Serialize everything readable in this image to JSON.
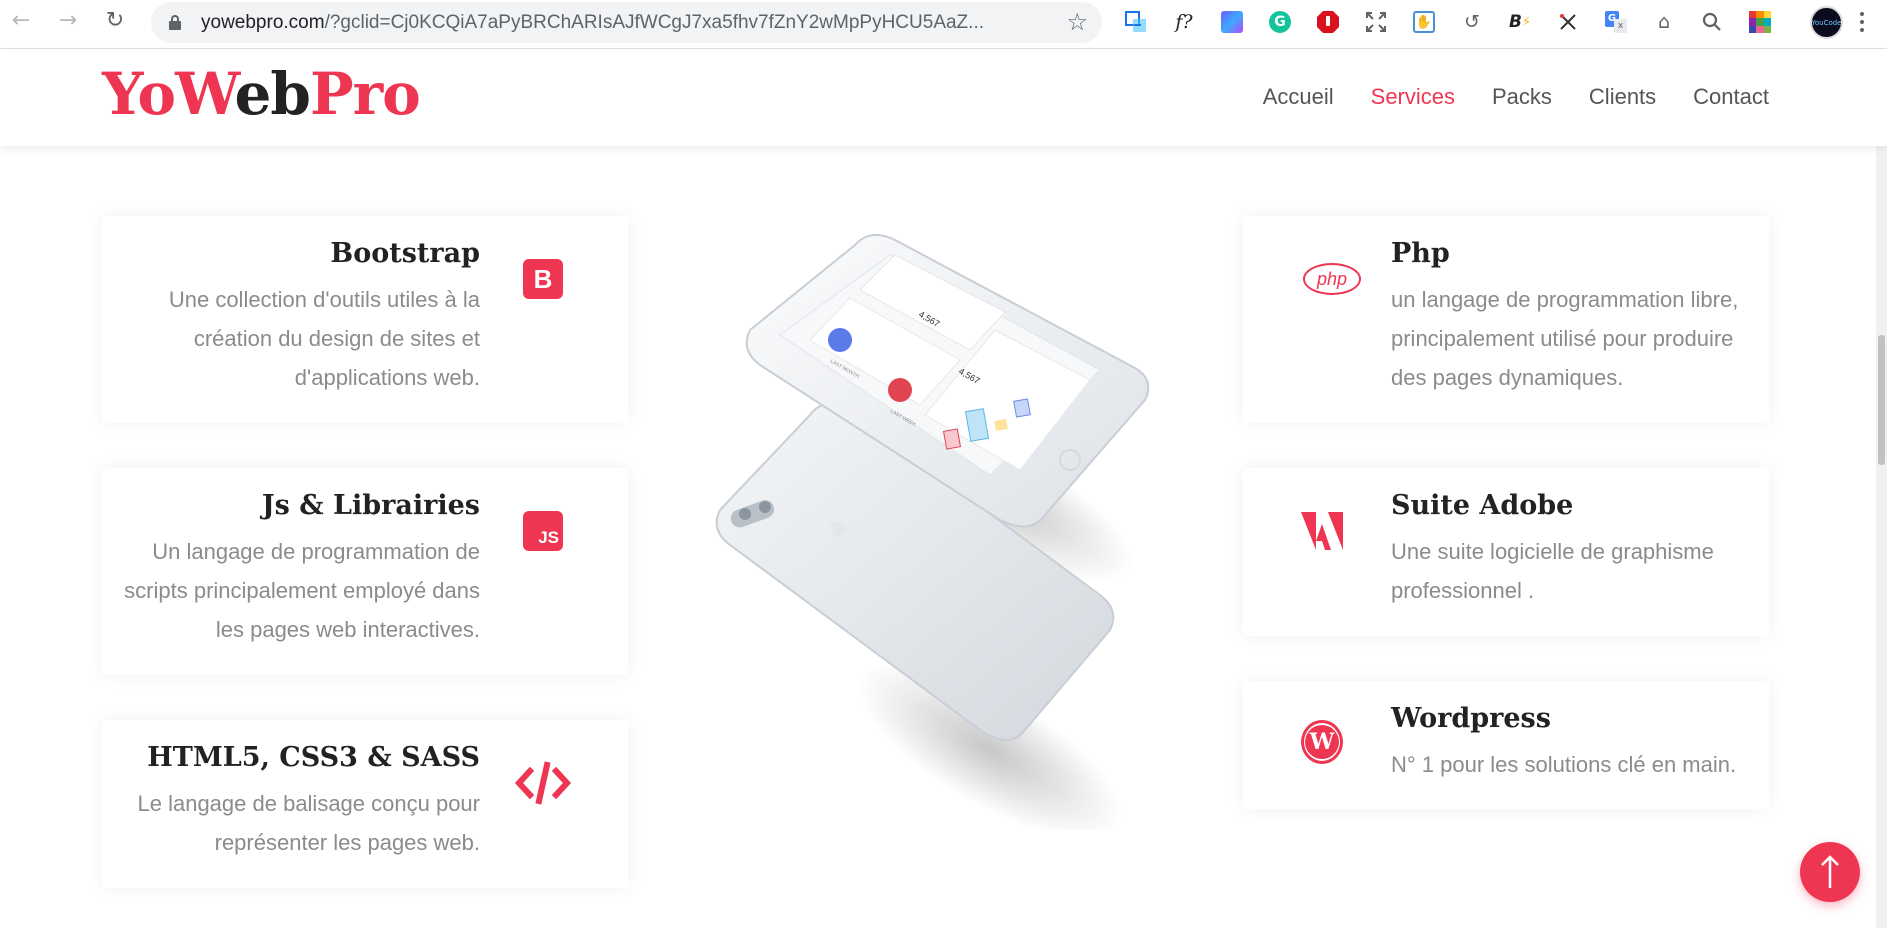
{
  "browser": {
    "url_main": "yowebpro.com",
    "url_rest": "/?gclid=Cj0KCQiA7aPyBRChARIsAJfWCgJ7xa5fhv7fZnY2wMpPyHCU5AaZ...",
    "ext_f_label": "f?",
    "ext_b_label": "B",
    "avatar_label": "YouCode"
  },
  "site": {
    "logo": {
      "p1": "Yo",
      "p2": "W",
      "p3": "eb",
      "p4": "Pro"
    },
    "nav": [
      {
        "label": "Accueil",
        "active": false
      },
      {
        "label": "Services",
        "active": true
      },
      {
        "label": "Packs",
        "active": false
      },
      {
        "label": "Clients",
        "active": false
      },
      {
        "label": "Contact",
        "active": false
      }
    ]
  },
  "services_left": [
    {
      "title": "Bootstrap",
      "desc": "Une collection d'outils utiles à la création du design de sites et d'applications web.",
      "icon": "bootstrap-icon",
      "icon_text": "B"
    },
    {
      "title": "Js & Librairies",
      "desc": "Un langage de programmation de scripts principalement employé dans les pages web interactives.",
      "icon": "js-icon",
      "icon_text": "JS"
    },
    {
      "title": "HTML5, CSS3 & SASS",
      "desc": "Le langage de balisage conçu pour représenter les pages web.",
      "icon": "code-icon",
      "icon_text": "</>"
    }
  ],
  "services_right": [
    {
      "title": "Php",
      "desc": "un langage de programmation libre, principalement utilisé pour produire des pages dynamiques.",
      "icon": "php-icon",
      "icon_text": "php"
    },
    {
      "title": "Suite Adobe",
      "desc": "Une suite logicielle de graphisme professionnel .",
      "icon": "adobe-icon"
    },
    {
      "title": "Wordpress",
      "desc": "N° 1 pour les solutions clé en main.",
      "icon": "wordpress-icon",
      "icon_text": "W"
    }
  ],
  "phone_screen": {
    "stat1_value": "4,567",
    "stat2_value": "4,567",
    "label1": "LAST MONTH",
    "label2": "LAST WEEK"
  },
  "colors": {
    "accent": "#ee3653",
    "text_dark": "#222222",
    "text_muted": "#8b8b8b"
  }
}
